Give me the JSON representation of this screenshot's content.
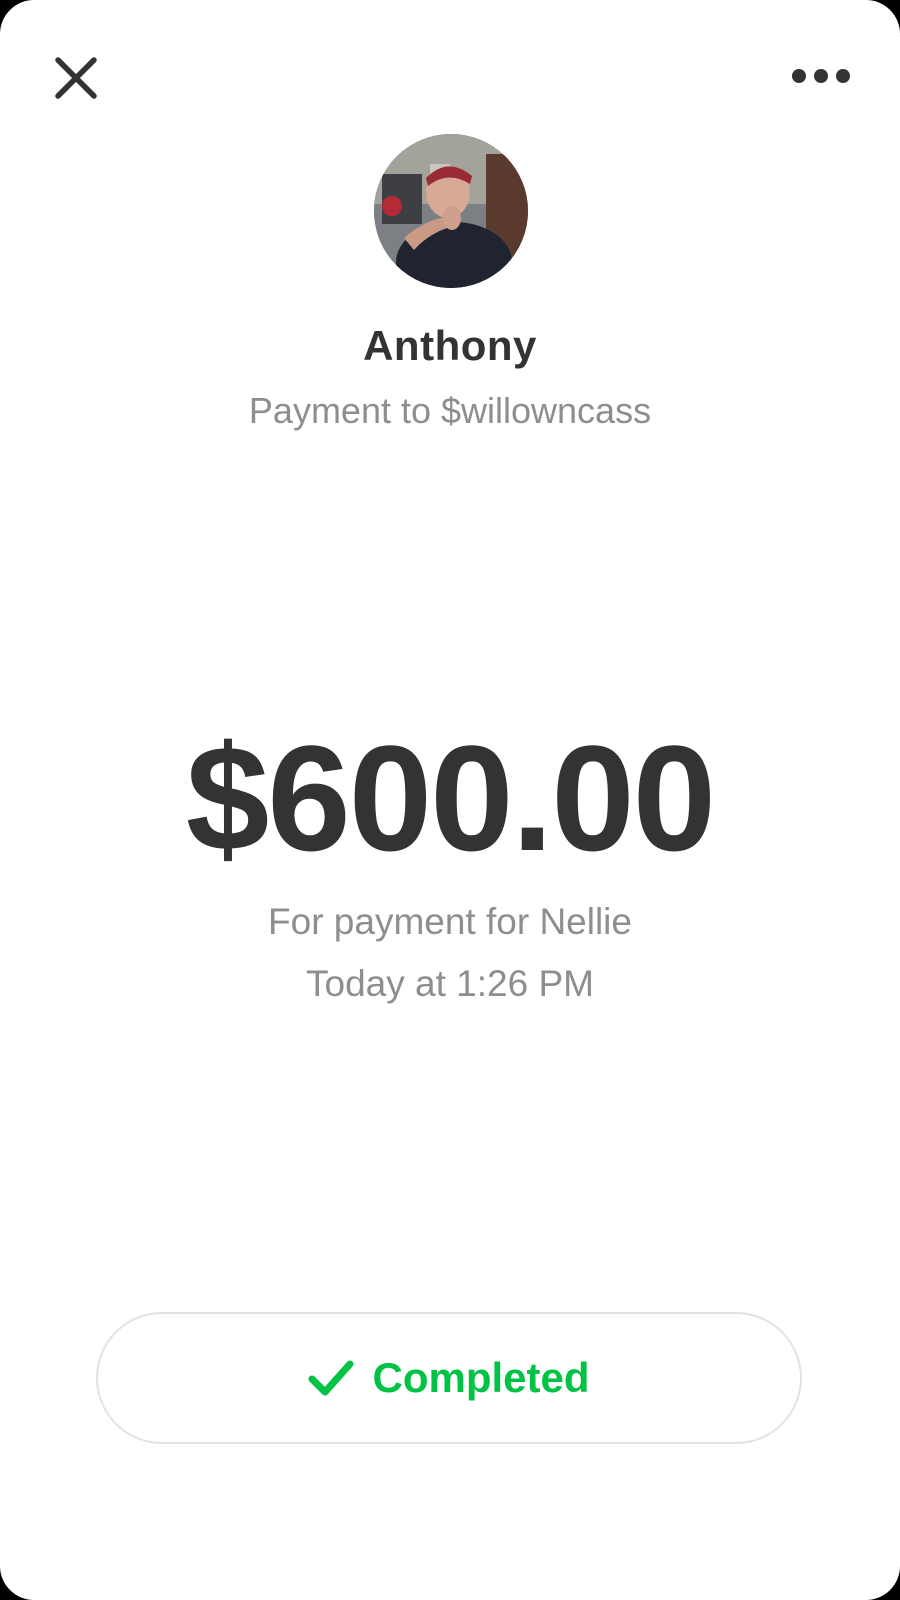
{
  "header": {
    "close_icon": "close-icon",
    "more_icon": "more-horizontal-icon"
  },
  "recipient": {
    "name": "Anthony",
    "subtitle": "Payment to $willowncass",
    "avatar": "profile-photo"
  },
  "payment": {
    "amount": "$600.00",
    "note": "For payment for Nellie",
    "time": "Today at 1:26 PM"
  },
  "status": {
    "label": "Completed",
    "icon": "checkmark-icon",
    "color": "#00c244"
  },
  "colors": {
    "text_primary": "#333333",
    "text_secondary": "#8e8e8e",
    "success": "#00c244",
    "background": "#ffffff"
  }
}
